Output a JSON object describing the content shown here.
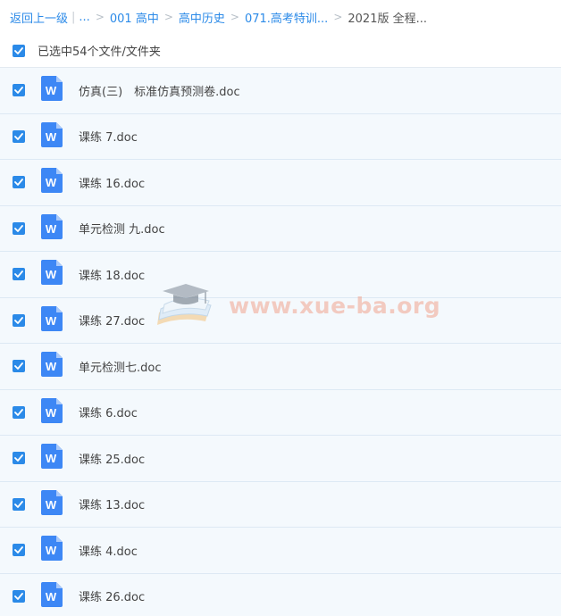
{
  "breadcrumb": {
    "back_label": "返回上一级",
    "bar": "|",
    "ellipsis": "...",
    "crumbs": [
      "001 高中",
      "高中历史",
      "071.高考特训..."
    ],
    "separator": ">",
    "current": "2021版 全程..."
  },
  "selection": {
    "summary": "已选中54个文件/文件夹"
  },
  "files": [
    {
      "name": "仿真(三)　标准仿真预测卷.doc",
      "icon": "word-doc-icon",
      "checked": true
    },
    {
      "name": "课练 7.doc",
      "icon": "word-doc-icon",
      "checked": true
    },
    {
      "name": "课练 16.doc",
      "icon": "word-doc-icon",
      "checked": true
    },
    {
      "name": "单元检测 九.doc",
      "icon": "word-doc-icon",
      "checked": true
    },
    {
      "name": "课练 18.doc",
      "icon": "word-doc-icon",
      "checked": true
    },
    {
      "name": "课练 27.doc",
      "icon": "word-doc-icon",
      "checked": true
    },
    {
      "name": "单元检测七.doc",
      "icon": "word-doc-icon",
      "checked": true
    },
    {
      "name": "课练 6.doc",
      "icon": "word-doc-icon",
      "checked": true
    },
    {
      "name": "课练 25.doc",
      "icon": "word-doc-icon",
      "checked": true
    },
    {
      "name": "课练 13.doc",
      "icon": "word-doc-icon",
      "checked": true
    },
    {
      "name": "课练 4.doc",
      "icon": "word-doc-icon",
      "checked": true
    },
    {
      "name": "课练 26.doc",
      "icon": "word-doc-icon",
      "checked": true
    }
  ],
  "watermark": {
    "text": "www.xue-ba.org",
    "icon": "graduation-cap-books-icon"
  },
  "colors": {
    "accent": "#2b8ae8",
    "row_background": "#f4f9fd",
    "word_icon": "#3d87f5"
  }
}
